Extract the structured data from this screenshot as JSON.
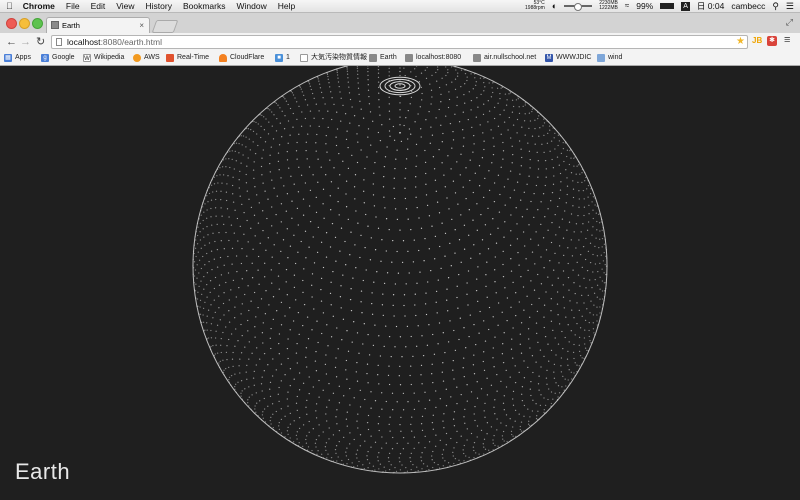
{
  "menubar": {
    "app_name": "Chrome",
    "menus": [
      "File",
      "Edit",
      "View",
      "History",
      "Bookmarks",
      "Window",
      "Help"
    ],
    "status": {
      "temp": "53°C",
      "rpm": "1988rpm",
      "mem_top": "2230MB",
      "mem_bottom": "1222MB",
      "battery": "99%",
      "input_method": "A",
      "clock": "日 0:04",
      "user": "cambecc"
    }
  },
  "browser": {
    "tab_title": "Earth",
    "url_host": "localhost",
    "url_rest": ":8080/earth.html",
    "extension_label": "JB"
  },
  "bookmarks": [
    {
      "label": "Apps",
      "icon": "apps-grid-icon",
      "color": "#4a7fd8"
    },
    {
      "label": "Google",
      "icon": "google-icon",
      "color": "#4a7fd8"
    },
    {
      "label": "Wikipedia",
      "icon": "wikipedia-icon",
      "color": "#333333"
    },
    {
      "label": "AWS",
      "icon": "aws-icon",
      "color": "#f29a20"
    },
    {
      "label": "Real-Time",
      "icon": "realtime-icon",
      "color": "#e0522e"
    },
    {
      "label": "CloudFlare",
      "icon": "cloudflare-icon",
      "color": "#f38020"
    },
    {
      "label": "1",
      "icon": "bookmark-1-icon",
      "color": "#4a90d9"
    },
    {
      "label": "大気汚染物質情報",
      "icon": "document-icon",
      "color": "#999999"
    },
    {
      "label": "Earth",
      "icon": "earth-favicon",
      "color": "#888888"
    },
    {
      "label": "localhost:8080",
      "icon": "localhost-favicon",
      "color": "#888888"
    },
    {
      "label": "air.nullschool.net",
      "icon": "nullschool-favicon",
      "color": "#888888"
    },
    {
      "label": "WWWJDIC",
      "icon": "wwwjdic-icon",
      "color": "#3355aa"
    },
    {
      "label": "wind",
      "icon": "folder-icon",
      "color": "#7fa7d9"
    }
  ],
  "page": {
    "title": "Earth"
  },
  "colors": {
    "background": "#1f1f1f",
    "grid_dots": "#d8d8d8"
  }
}
